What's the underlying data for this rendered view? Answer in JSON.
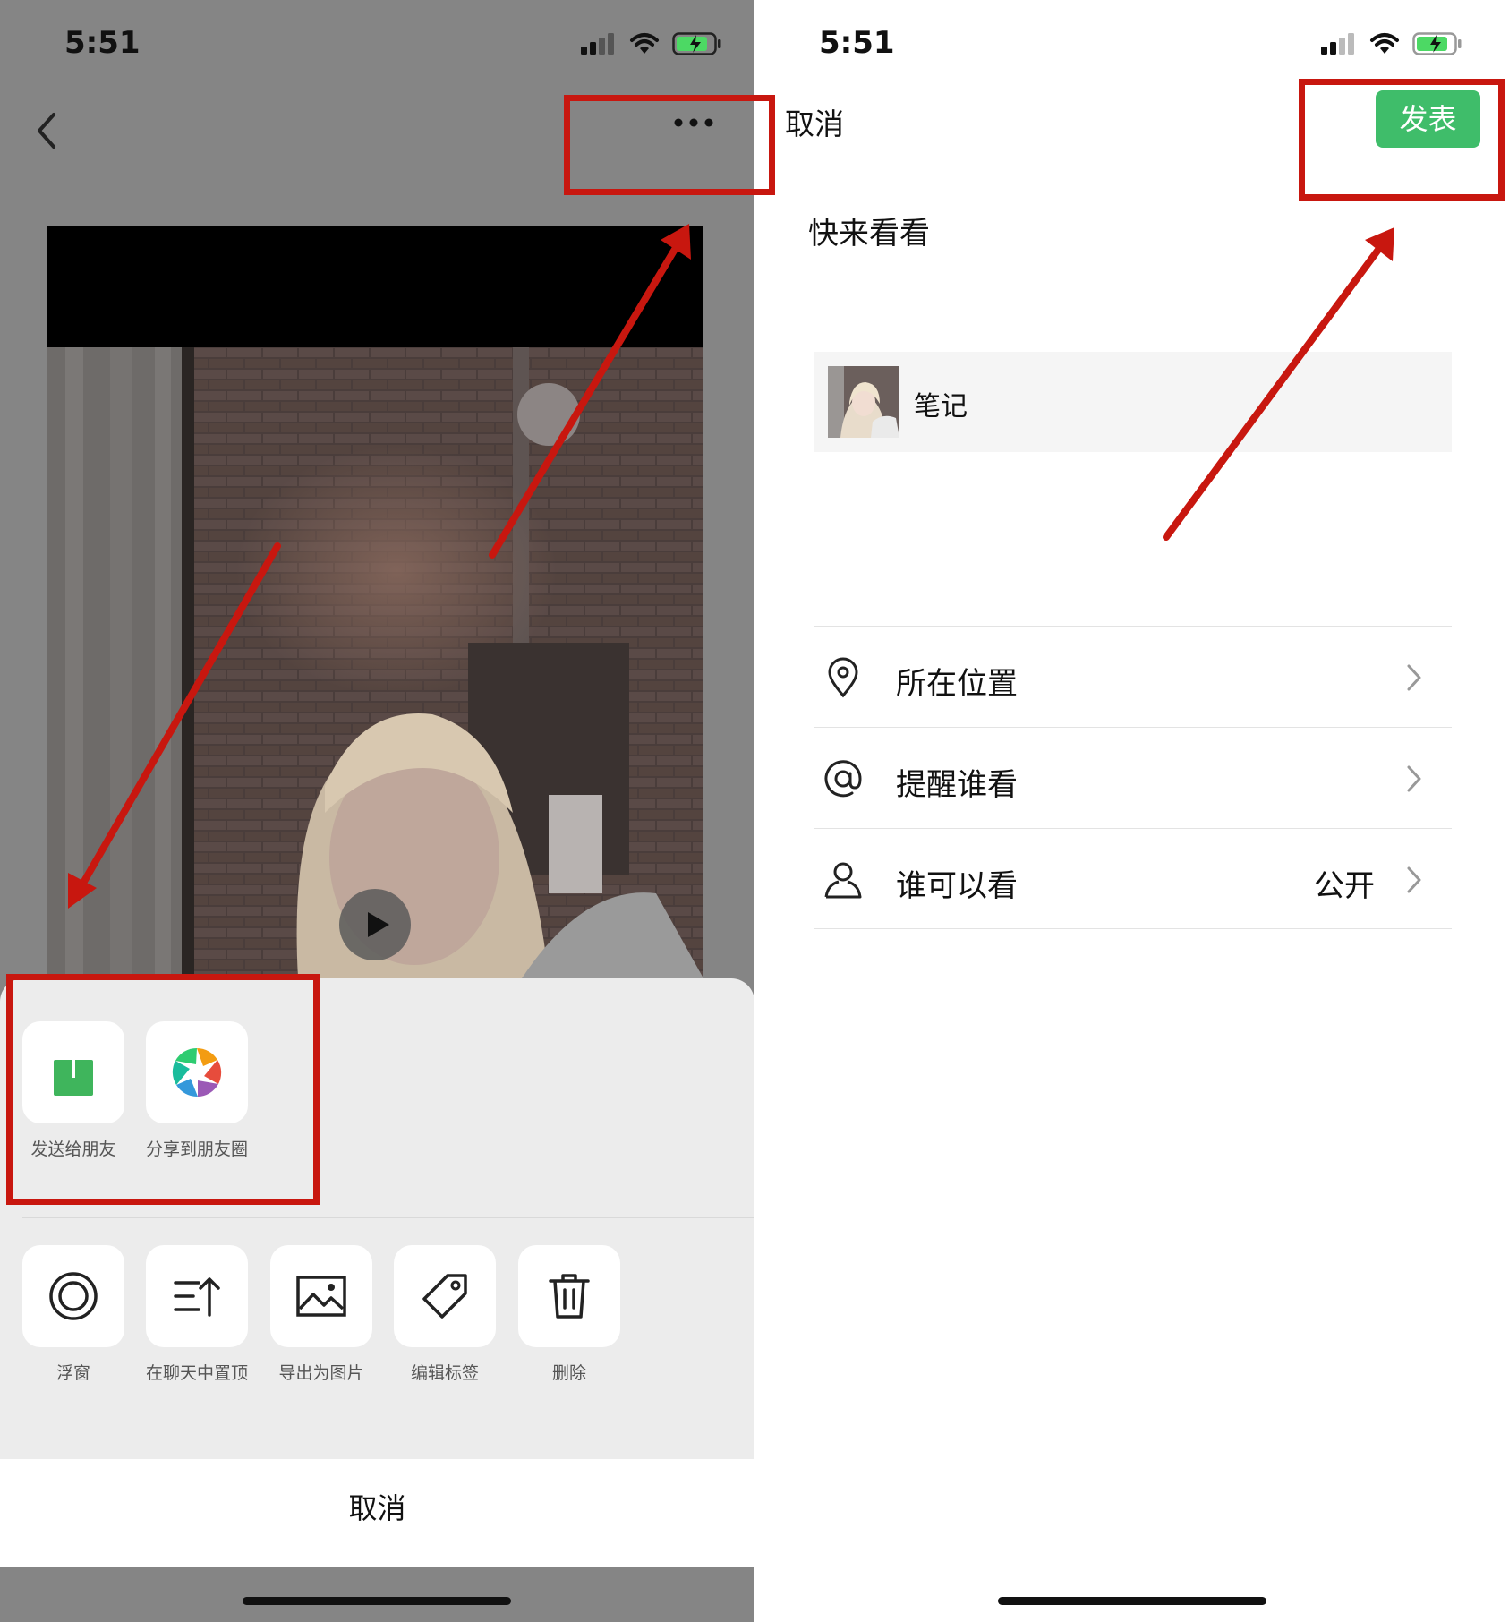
{
  "left_screen": {
    "status": {
      "time": "5:51"
    },
    "share_sheet": {
      "primary_actions": [
        {
          "label": "发送给朋友",
          "icon": "share-upload-icon"
        },
        {
          "label": "分享到朋友圈",
          "icon": "moments-aperture-icon"
        }
      ],
      "secondary_actions": [
        {
          "label": "浮窗",
          "icon": "floating-window-icon"
        },
        {
          "label": "在聊天中置顶",
          "icon": "pin-to-top-icon"
        },
        {
          "label": "导出为图片",
          "icon": "export-image-icon"
        },
        {
          "label": "编辑标签",
          "icon": "tag-icon"
        },
        {
          "label": "删除",
          "icon": "trash-icon"
        }
      ],
      "cancel_label": "取消"
    }
  },
  "right_screen": {
    "status": {
      "time": "5:51"
    },
    "nav": {
      "cancel_label": "取消",
      "publish_label": "发表"
    },
    "post_text": "快来看看",
    "link_card": {
      "title": "笔记"
    },
    "options": [
      {
        "label": "所在位置",
        "value": "",
        "icon": "location-pin-icon"
      },
      {
        "label": "提醒谁看",
        "value": "",
        "icon": "at-sign-icon"
      },
      {
        "label": "谁可以看",
        "value": "公开",
        "icon": "person-icon"
      }
    ]
  },
  "colors": {
    "accent_green": "#3fbd6a",
    "annotation_red": "#c8170f",
    "overlay_gray": "#858585"
  }
}
